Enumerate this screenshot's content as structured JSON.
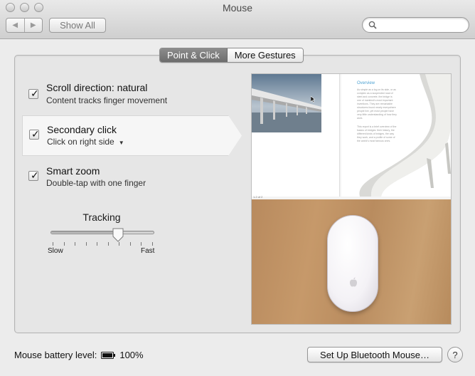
{
  "window": {
    "title": "Mouse"
  },
  "toolbar": {
    "back_glyph": "◀",
    "forward_glyph": "▶",
    "show_all_label": "Show All",
    "search_placeholder": "",
    "search_value": ""
  },
  "tabs": [
    {
      "label": "Point & Click",
      "selected": true
    },
    {
      "label": "More Gestures",
      "selected": false
    }
  ],
  "options": [
    {
      "title": "Scroll direction: natural",
      "subtitle": "Content tracks finger movement",
      "checked": true
    },
    {
      "title": "Secondary click",
      "subtitle": "Click on right side",
      "checked": true,
      "has_popup": true
    },
    {
      "title": "Smart zoom",
      "subtitle": "Double-tap with one finger",
      "checked": true
    }
  ],
  "check_glyph": "✓",
  "popup_glyph": "▼",
  "tracking": {
    "label": "Tracking",
    "min_label": "Slow",
    "max_label": "Fast",
    "value_fraction": 0.65,
    "tick_count": 10
  },
  "preview": {
    "doc_heading": "Overview",
    "doc_para_1": "As simple as a log on its side, or as complex as a suspended road of steel and concrete, the bridge is one of mankind's most important inventions. They are remarkable structures found nearly everywhere people live, yet most people have very little understanding of how they work.",
    "doc_para_2": "This report is a brief overview of the basics of bridges: their history, the different kinds of bridges, the way they work, and a profile of some of the world's most famous ones.",
    "doc_status": "1.2 of 2"
  },
  "battery": {
    "label": "Mouse battery level:",
    "value": "100%"
  },
  "bluetooth_button_label": "Set Up Bluetooth Mouse…",
  "help_label": "?",
  "colors": {
    "selected_tab": "#7a7a7a",
    "wood": "#c09467",
    "doc_heading": "#4fa3d3"
  }
}
